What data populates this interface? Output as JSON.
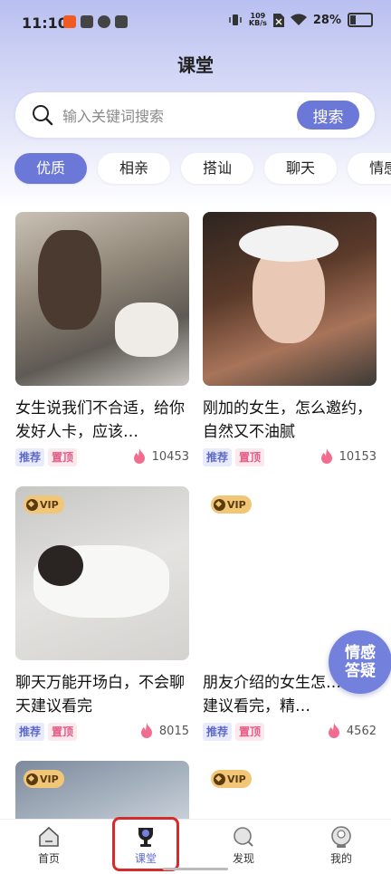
{
  "status": {
    "time": "11:10",
    "net_speed": "109",
    "net_unit": "KB/s",
    "battery": "28%"
  },
  "header": {
    "title": "课堂"
  },
  "search": {
    "placeholder": "输入关键词搜索",
    "button": "搜索"
  },
  "tabs": [
    {
      "label": "优质",
      "active": true
    },
    {
      "label": "相亲"
    },
    {
      "label": "搭讪"
    },
    {
      "label": "聊天"
    },
    {
      "label": "情感"
    }
  ],
  "cards": [
    {
      "title": "女生说我们不合适，给你发好人卡，应该…",
      "tag1": "推荐",
      "tag2": "置顶",
      "views": "10453",
      "vip": ""
    },
    {
      "title": "刚加的女生，怎么邀约，自然又不油腻",
      "tag1": "推荐",
      "tag2": "置顶",
      "views": "10153",
      "vip": ""
    },
    {
      "title": "聊天万能开场白，不会聊天建议看完",
      "tag1": "推荐",
      "tag2": "置顶",
      "views": "8015",
      "vip": "VIP"
    },
    {
      "title": "朋友介绍的女生怎…场，建议看完，精…",
      "tag1": "推荐",
      "tag2": "置顶",
      "views": "4562",
      "vip": "VIP"
    },
    {
      "vip": "VIP"
    },
    {
      "vip": "VIP"
    }
  ],
  "floating": {
    "line1": "情感",
    "line2": "答疑"
  },
  "nav": [
    {
      "label": "首页",
      "icon": "home-icon"
    },
    {
      "label": "课堂",
      "icon": "trophy-icon",
      "active": true
    },
    {
      "label": "发现",
      "icon": "discover-icon"
    },
    {
      "label": "我的",
      "icon": "profile-icon"
    }
  ],
  "colors": {
    "accent": "#6b78d8",
    "highlight": "#d62b2b",
    "tag_rec": "#5e69c8",
    "tag_top": "#e35c83"
  }
}
